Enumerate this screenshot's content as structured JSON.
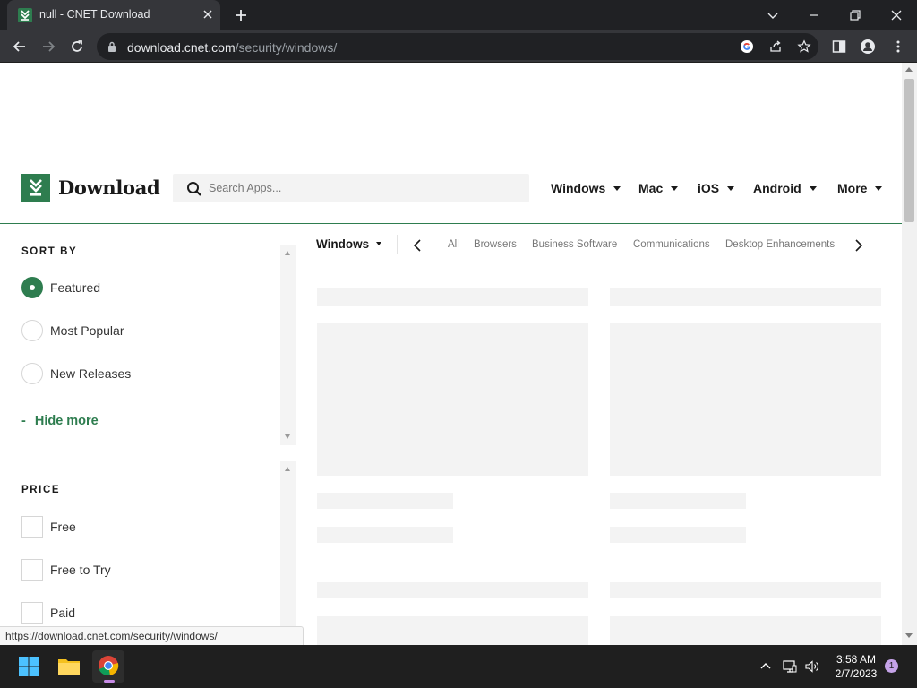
{
  "browser": {
    "tab_title": "null - CNET Download",
    "url_host": "download.cnet.com",
    "url_path": "/security/windows/",
    "status_url": "https://download.cnet.com/security/windows/"
  },
  "header": {
    "logo_text": "Download",
    "search_placeholder": "Search Apps...",
    "nav": [
      "Windows",
      "Mac",
      "iOS",
      "Android",
      "More"
    ]
  },
  "sidebar": {
    "sort_title": "SORT BY",
    "sort_options": [
      {
        "label": "Featured",
        "selected": true
      },
      {
        "label": "Most Popular",
        "selected": false
      },
      {
        "label": "New Releases",
        "selected": false
      }
    ],
    "hide_more_dash": "-",
    "hide_more": "Hide more",
    "price_title": "PRICE",
    "price_options": [
      "Free",
      "Free to Try",
      "Paid"
    ]
  },
  "categories": {
    "platform": "Windows",
    "items": [
      "All",
      "Browsers",
      "Business Software",
      "Communications",
      "Desktop Enhancements"
    ]
  },
  "taskbar": {
    "time": "3:58 AM",
    "date": "2/7/2023",
    "notification_count": "1"
  },
  "colors": {
    "brand_green": "#2e7d4f",
    "chrome_dark": "#202124",
    "chrome_toolbar": "#35363a"
  },
  "icons": [
    "cnet-download-favicon",
    "close-icon",
    "plus-icon",
    "chevron-down-icon",
    "minimize-icon",
    "restore-icon",
    "back-arrow-icon",
    "forward-arrow-icon",
    "reload-icon",
    "lock-icon",
    "google-icon",
    "share-icon",
    "star-icon",
    "sidepanel-icon",
    "profile-icon",
    "kebab-menu-icon",
    "search-icon",
    "chevron-left-icon",
    "chevron-right-icon",
    "windows-start-icon",
    "file-explorer-icon",
    "chrome-icon",
    "chevron-up-icon",
    "network-icon",
    "volume-icon"
  ]
}
